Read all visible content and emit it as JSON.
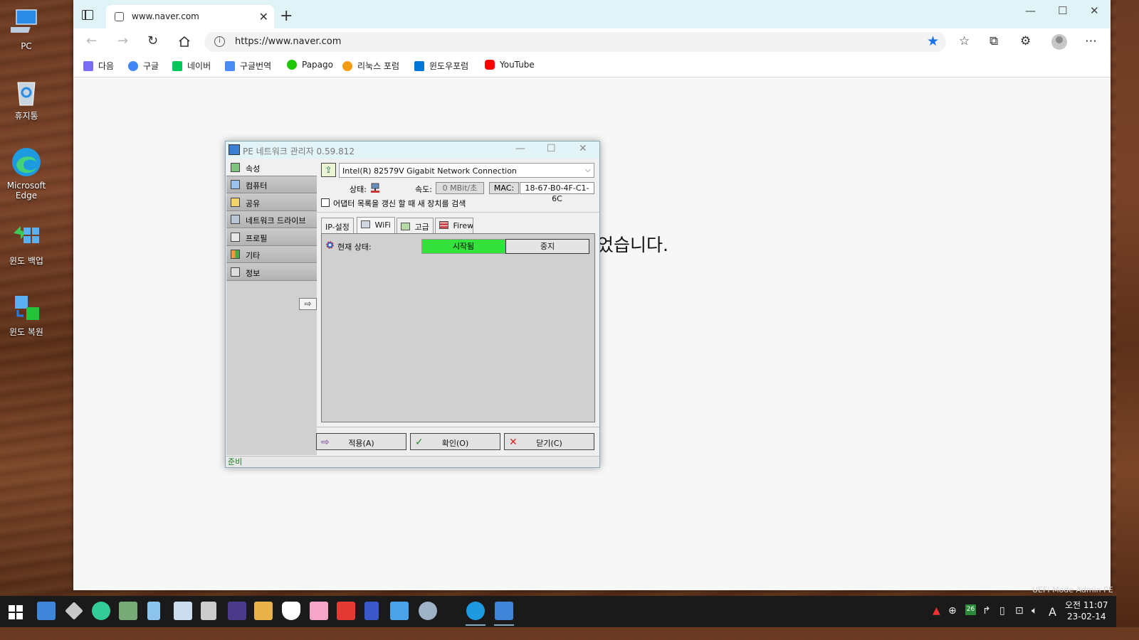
{
  "desktop": {
    "icons": [
      {
        "label": "PC"
      },
      {
        "label": "휴지통"
      },
      {
        "label": "Microsoft Edge"
      },
      {
        "label": "윈도 백업"
      },
      {
        "label": "윈도 복원"
      }
    ],
    "watermark": "UEFI Mode Admin PE"
  },
  "browser": {
    "tab_title": "www.naver.com",
    "address": "https://www.naver.com",
    "bookmarks": [
      {
        "label": "다음",
        "color": "#7b6cf6"
      },
      {
        "label": "구글",
        "color": "#4285f4"
      },
      {
        "label": "네이버",
        "color": "#03c75a"
      },
      {
        "label": "구글번역",
        "color": "#4a8af4"
      },
      {
        "label": "Papago",
        "color": "#1ec800"
      },
      {
        "label": "리눅스 포럼",
        "color": "#f39c12"
      },
      {
        "label": "윈도우포럼",
        "color": "#0078d7"
      },
      {
        "label": "YouTube",
        "color": "#ff0000"
      }
    ],
    "page_message": "었습니다."
  },
  "dialog": {
    "title": "PE 네트워크 관리자 0.59.812",
    "sidebar": [
      {
        "label": "속성",
        "icon": "properties-icon"
      },
      {
        "label": "컴퓨터",
        "icon": "computer-icon"
      },
      {
        "label": "공유",
        "icon": "share-icon"
      },
      {
        "label": "네트워크 드라이브",
        "icon": "network-drive-icon"
      },
      {
        "label": "프로필",
        "icon": "profile-icon"
      },
      {
        "label": "기타",
        "icon": "misc-icon"
      },
      {
        "label": "정보",
        "icon": "info-icon"
      }
    ],
    "adapter": "Intel(R) 82579V Gigabit Network Connection",
    "status_label": "상태:",
    "speed_label": "속도:",
    "speed_value": "0 MBit/초",
    "mac_label": "MAC:",
    "mac_value": "18-67-B0-4F-C1-6C",
    "refresh_checkbox": "어댑터 목록을 갱신 할 때 새 장치를 검색",
    "tabs": [
      {
        "label": "IP-설정"
      },
      {
        "label": "WiFi"
      },
      {
        "label": "고급"
      },
      {
        "label": "Firew"
      }
    ],
    "current_status_label": "현재 상태:",
    "started": "시작됨",
    "stop": "중지",
    "buttons": {
      "apply": "적용(A)",
      "ok": "확인(O)",
      "close": "닫기(C)"
    },
    "statusbar": "준비"
  },
  "taskbar": {
    "tray_badge": "26",
    "ime": "A",
    "clock_time": "오전 11:07",
    "clock_date": "23-02-14"
  }
}
